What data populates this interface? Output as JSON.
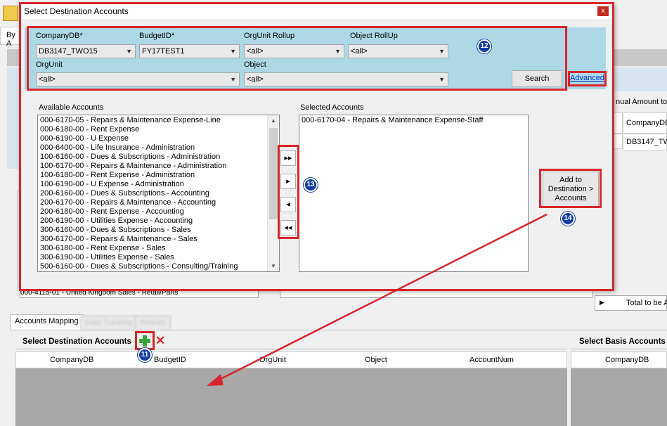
{
  "background": {
    "tab_by": "By A",
    "annual_amount_header": "nual Amount to",
    "right_grid_header": "CompanyDB",
    "right_grid_cell": "DB3147_TW",
    "bottom_left_value": "000-4115-01 - United Kingdom Sales - Retail/Parts",
    "total_label": "Total to be A",
    "tabs": [
      "Accounts Mapping",
      "Data Tracking",
      "Results"
    ],
    "select_dest_title": "Select Destination Accounts",
    "select_basis_title": "Select Basis Accounts",
    "dest_columns": [
      "CompanyDB",
      "BudgetID",
      "OrgUnit",
      "Object",
      "AccountNum"
    ],
    "basis_columns": [
      "CompanyDB"
    ]
  },
  "dialog": {
    "title": "Select Destination Accounts",
    "close": "x",
    "filters": {
      "company_label": "CompanyDB*",
      "company_value": "DB3147_TWO15",
      "budget_label": "BudgetID*",
      "budget_value": "FY17TEST1",
      "orgunit_rollup_label": "OrgUnit Rollup",
      "orgunit_rollup_value": "<all>",
      "object_rollup_label": "Object RollUp",
      "object_rollup_value": "<all>",
      "orgunit_label": "OrgUnit",
      "orgunit_value": "<all>",
      "object_label": "Object",
      "object_value": "<all>",
      "search_button": "Search",
      "advanced_link": "Advanced"
    },
    "available_label": "Available Accounts",
    "available_accounts": [
      "000-6170-05 - Repairs & Maintenance Expense-Line",
      "000-6180-00 - Rent Expense",
      "000-6190-00 - U Expense",
      "000-6400-00 - Life Insurance - Administration",
      "100-6160-00 - Dues & Subscriptions - Administration",
      "100-6170-00 - Repairs & Maintenance - Administration",
      "100-6180-00 - Rent Expense - Administration",
      "100-6190-00 - U Expense - Administration",
      "200-6160-00 - Dues & Subscriptions - Accounting",
      "200-6170-00 - Repairs & Maintenance - Accounting",
      "200-6180-00 - Rent Expense - Accounting",
      "200-6190-00 - Utilities Expense - Accounting",
      "300-6160-00 - Dues & Subscriptions - Sales",
      "300-6170-00 - Repairs & Maintenance - Sales",
      "300-6180-00 - Rent Expense - Sales",
      "300-6190-00 - Utilities Expense - Sales",
      "500-6160-00 - Dues & Subscriptions - Consulting/Training"
    ],
    "selected_label": "Selected Accounts",
    "selected_accounts": [
      "000-6170-04 - Repairs & Maintenance Expense-Staff"
    ],
    "move_buttons": [
      "▸▸",
      "▸",
      "◂",
      "◂◂"
    ],
    "add_button_lines": [
      "Add to",
      "Destination",
      "Accounts"
    ],
    "add_button_arrow": ">"
  },
  "badges": {
    "b11": "11",
    "b12": "12",
    "b13": "13",
    "b14": "14"
  },
  "colors": {
    "annotation_red": "#d9252b",
    "badge_blue": "#123ca8",
    "filter_panel": "#add8e6"
  }
}
